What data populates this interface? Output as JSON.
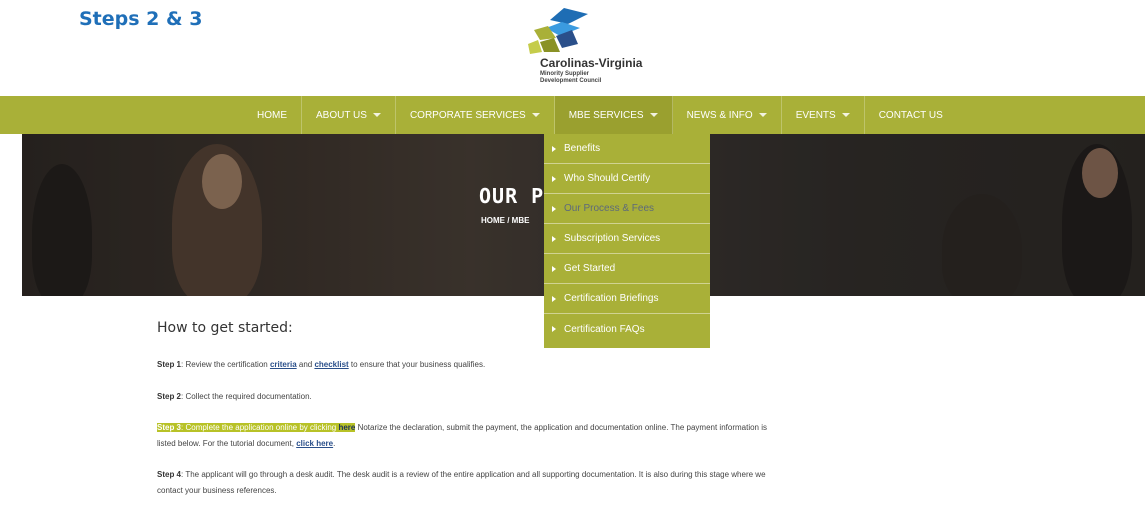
{
  "slide": {
    "title": "Steps 2 & 3"
  },
  "logo": {
    "name": "Carolinas-Virginia",
    "sub1": "Minority Supplier",
    "sub2": "Development Council"
  },
  "nav": {
    "items": [
      {
        "label": "HOME",
        "caret": false
      },
      {
        "label": "ABOUT US",
        "caret": true
      },
      {
        "label": "CORPORATE SERVICES",
        "caret": true
      },
      {
        "label": "MBE SERVICES",
        "caret": true
      },
      {
        "label": "NEWS & INFO",
        "caret": true
      },
      {
        "label": "EVENTS",
        "caret": true
      },
      {
        "label": "CONTACT US",
        "caret": false
      }
    ]
  },
  "hero": {
    "title": "OUR P",
    "breadcrumb": "HOME / MBE"
  },
  "dropdown": {
    "items": [
      {
        "label": "Benefits"
      },
      {
        "label": "Who Should Certify"
      },
      {
        "label": "Our Process & Fees"
      },
      {
        "label": "Subscription Services"
      },
      {
        "label": "Get Started"
      },
      {
        "label": "Certification Briefings"
      },
      {
        "label": "Certification FAQs"
      }
    ]
  },
  "content": {
    "heading": "How to get started:",
    "step1": {
      "label": "Step 1",
      "t1": ": Review the certification ",
      "link1": "criteria",
      "t2": " and ",
      "link2": "checklist",
      "t3": " to ensure that your business qualifies."
    },
    "step2": {
      "label": "Step 2",
      "t1": ": Collect the required documentation."
    },
    "step3": {
      "label": "Step 3",
      "hl_text": ": Complete the application online by clicking ",
      "hl_link": "here",
      "t1": " Notarize the declaration, submit the payment, the application and documentation online. The payment information is",
      "t2": "listed below. For the tutorial document, ",
      "link": "click here",
      "t3": "."
    },
    "step4": {
      "label": "Step 4",
      "t1": ": The applicant will go through a desk audit. The desk audit is a review of the entire application and all supporting documentation. It is also during this stage where we",
      "t2": "contact your business references."
    }
  },
  "colors": {
    "nav": "#a9b038",
    "title": "#1f6fb8",
    "highlight": "#b8c227"
  }
}
